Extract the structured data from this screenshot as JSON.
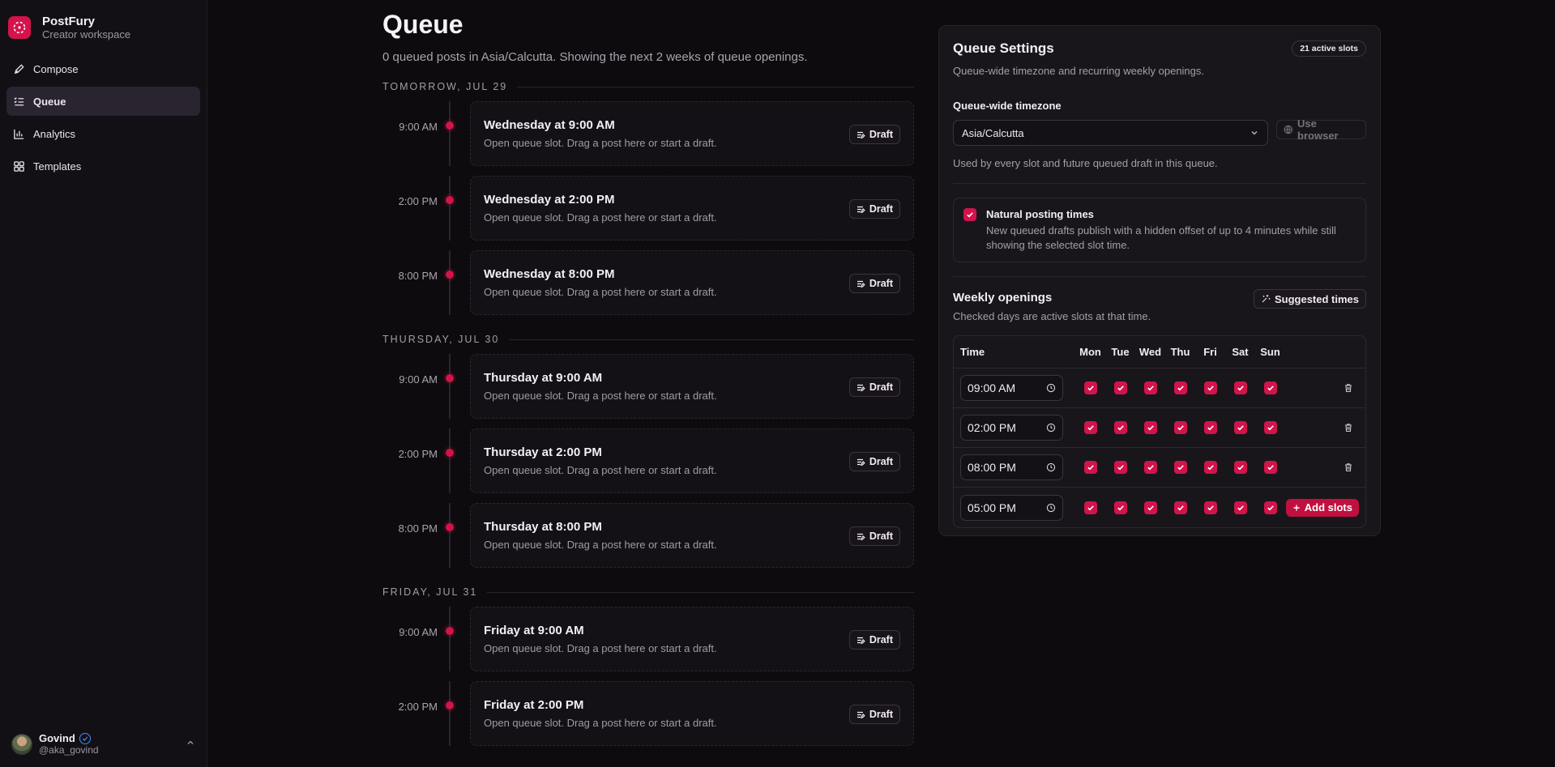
{
  "brand": {
    "name": "PostFury",
    "subtitle": "Creator workspace"
  },
  "nav": [
    {
      "label": "Compose",
      "icon": "pen-icon",
      "active": false
    },
    {
      "label": "Queue",
      "icon": "list-checks-icon",
      "active": true
    },
    {
      "label": "Analytics",
      "icon": "bar-chart-icon",
      "active": false
    },
    {
      "label": "Templates",
      "icon": "grid-icon",
      "active": false
    }
  ],
  "user": {
    "name": "Govind",
    "handle": "@aka_govind"
  },
  "page": {
    "title": "Queue",
    "subtitle": "0 queued posts in Asia/Calcutta. Showing the next 2 weeks of queue openings."
  },
  "draft_label": "Draft",
  "slot_description": "Open queue slot. Drag a post here or start a draft.",
  "days": [
    {
      "heading": "TOMORROW, JUL 29",
      "slots": [
        {
          "time": "9:00 AM",
          "title": "Wednesday at 9:00 AM"
        },
        {
          "time": "2:00 PM",
          "title": "Wednesday at 2:00 PM"
        },
        {
          "time": "8:00 PM",
          "title": "Wednesday at 8:00 PM"
        }
      ]
    },
    {
      "heading": "THURSDAY, JUL 30",
      "slots": [
        {
          "time": "9:00 AM",
          "title": "Thursday at 9:00 AM"
        },
        {
          "time": "2:00 PM",
          "title": "Thursday at 2:00 PM"
        },
        {
          "time": "8:00 PM",
          "title": "Thursday at 8:00 PM"
        }
      ]
    },
    {
      "heading": "FRIDAY, JUL 31",
      "slots": [
        {
          "time": "9:00 AM",
          "title": "Friday at 9:00 AM"
        },
        {
          "time": "2:00 PM",
          "title": "Friday at 2:00 PM"
        }
      ]
    }
  ],
  "settings": {
    "title": "Queue Settings",
    "badge": "21 active slots",
    "subtitle": "Queue-wide timezone and recurring weekly openings.",
    "tz_label": "Queue-wide timezone",
    "tz_value": "Asia/Calcutta",
    "use_browser": "Use browser",
    "tz_help": "Used by every slot and future queued draft in this queue.",
    "natural_title": "Natural posting times",
    "natural_desc": "New queued drafts publish with a hidden offset of up to 4 minutes while still showing the selected slot time.",
    "natural_checked": true,
    "weekly_title": "Weekly openings",
    "weekly_sub": "Checked days are active slots at that time.",
    "suggested": "Suggested times",
    "col_time": "Time",
    "weekdays": [
      "Mon",
      "Tue",
      "Wed",
      "Thu",
      "Fri",
      "Sat",
      "Sun"
    ],
    "rows": [
      {
        "time": "09:00 AM",
        "action": "delete"
      },
      {
        "time": "02:00 PM",
        "action": "delete"
      },
      {
        "time": "08:00 PM",
        "action": "delete"
      },
      {
        "time": "05:00 PM",
        "action": "add"
      }
    ],
    "add_slots": "Add slots"
  },
  "colors": {
    "accent": "#d3134b",
    "background": "#0d0b0e",
    "panel": "#19161b"
  }
}
